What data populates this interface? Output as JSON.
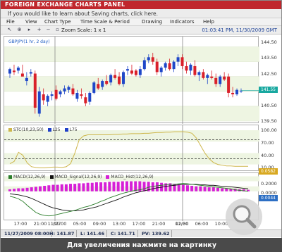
{
  "header": {
    "title": "FOREIGN EXCHANGE CHARTS PANEL",
    "info_link": "If you would like to learn about Saving charts, click here."
  },
  "menu": {
    "items": [
      "File",
      "View",
      "Chart Type",
      "Time Scale & Period",
      "Drawing",
      "Indicators",
      "Help"
    ]
  },
  "toolbar": {
    "zoom_label": "Zoom Scale: 1 x 1",
    "datetime": "01:03:41 PM, 11/30/2009 GMT"
  },
  "icons": [
    "pointer-icon",
    "crosshair-icon",
    "pan-icon",
    "zoom-in-icon",
    "zoom-out-icon",
    "zoom-fit-icon"
  ],
  "colors": {
    "header_red": "#c0272d",
    "bull": "#1f47c8",
    "bear": "#d9202a",
    "stc": "#cdb64a",
    "macd": "#2a7d2a",
    "signal": "#111111",
    "hist": "#d61fd6",
    "price_tag": "#18a8a0",
    "stc_tag": "#d8a820",
    "macd_tag": "#2d6fc4"
  },
  "price_panel": {
    "legend": "GBPJPY(1 hr, 2 day)",
    "y_ticks": [
      "144.50",
      "143.50",
      "142.50",
      "141.50",
      "140.50",
      "139.50"
    ],
    "last_price": "141.55"
  },
  "stc_panel": {
    "legend_items": [
      "STC(10,23,50)",
      "L25",
      "L75"
    ],
    "y_ticks": [
      "100.00",
      "70.00",
      "40.00",
      "10.00"
    ],
    "last_value": "0.0582"
  },
  "macd_panel": {
    "legend_items": [
      "MACD(12,26,9)",
      "MACD_Signal(12,26,9)",
      "MACD_Hist(12,26,9)"
    ],
    "y_ticks": [
      "0.2000",
      "0.0000"
    ],
    "last_value": "0.0044"
  },
  "x_axis": {
    "labels": [
      "17:00",
      "21:00",
      "01:00",
      "05:00",
      "09:00",
      "13:00",
      "17:00",
      "21:00",
      "02:00",
      "06:00",
      "10:00"
    ],
    "date_labels": [
      "11/27",
      "11/30"
    ]
  },
  "status": {
    "datetime": "11/27/2009 08:00",
    "high": "H: 141.87",
    "low": "L: 141.46",
    "close": "C: 141.71",
    "pivot": "PV: 139.62"
  },
  "caption": "Для увеличения нажмите на картинку",
  "chart_data": [
    {
      "type": "candlestick",
      "title": "GBPJPY(1 hr, 2 day)",
      "ylim": [
        139.5,
        145.0
      ],
      "candles": [
        {
          "o": 142.7,
          "h": 143.1,
          "l": 142.4,
          "c": 143.0
        },
        {
          "o": 142.9,
          "h": 143.3,
          "l": 142.6,
          "c": 142.8
        },
        {
          "o": 142.9,
          "h": 143.2,
          "l": 142.7,
          "c": 143.1
        },
        {
          "o": 142.7,
          "h": 143.3,
          "l": 142.5,
          "c": 142.5
        },
        {
          "o": 142.2,
          "h": 142.8,
          "l": 141.9,
          "c": 142.4
        },
        {
          "o": 142.7,
          "h": 143.0,
          "l": 142.5,
          "c": 142.8
        },
        {
          "o": 142.7,
          "h": 142.9,
          "l": 140.0,
          "c": 140.4
        },
        {
          "o": 140.0,
          "h": 141.8,
          "l": 139.8,
          "c": 141.5
        },
        {
          "o": 141.3,
          "h": 141.7,
          "l": 140.6,
          "c": 140.9
        },
        {
          "o": 140.8,
          "h": 141.3,
          "l": 140.5,
          "c": 141.2
        },
        {
          "o": 141.2,
          "h": 141.5,
          "l": 140.9,
          "c": 141.3
        },
        {
          "o": 141.6,
          "h": 141.9,
          "l": 140.9,
          "c": 141.0
        },
        {
          "o": 141.3,
          "h": 141.6,
          "l": 141.1,
          "c": 141.5
        },
        {
          "o": 141.5,
          "h": 141.9,
          "l": 141.3,
          "c": 141.7
        },
        {
          "o": 141.6,
          "h": 141.9,
          "l": 141.4,
          "c": 141.8
        },
        {
          "o": 141.7,
          "h": 142.0,
          "l": 141.2,
          "c": 141.3
        },
        {
          "o": 141.0,
          "h": 141.6,
          "l": 140.8,
          "c": 141.4
        },
        {
          "o": 141.3,
          "h": 141.7,
          "l": 141.0,
          "c": 141.2
        },
        {
          "o": 141.1,
          "h": 141.4,
          "l": 140.5,
          "c": 140.7
        },
        {
          "o": 140.8,
          "h": 141.5,
          "l": 140.6,
          "c": 141.4
        },
        {
          "o": 141.4,
          "h": 142.2,
          "l": 141.3,
          "c": 142.1
        },
        {
          "o": 142.0,
          "h": 142.4,
          "l": 141.6,
          "c": 141.7
        },
        {
          "o": 141.8,
          "h": 142.3,
          "l": 141.6,
          "c": 142.2
        },
        {
          "o": 142.2,
          "h": 142.6,
          "l": 141.9,
          "c": 142.0
        },
        {
          "o": 142.1,
          "h": 142.7,
          "l": 141.9,
          "c": 142.6
        },
        {
          "o": 142.6,
          "h": 143.0,
          "l": 142.3,
          "c": 142.4
        },
        {
          "o": 142.5,
          "h": 142.8,
          "l": 141.9,
          "c": 142.0
        },
        {
          "o": 142.0,
          "h": 142.9,
          "l": 141.8,
          "c": 142.8
        },
        {
          "o": 142.9,
          "h": 143.2,
          "l": 142.6,
          "c": 143.0
        },
        {
          "o": 142.9,
          "h": 143.3,
          "l": 142.6,
          "c": 142.7
        },
        {
          "o": 142.9,
          "h": 143.0,
          "l": 142.5,
          "c": 142.6
        },
        {
          "o": 142.6,
          "h": 143.2,
          "l": 142.4,
          "c": 143.0
        },
        {
          "o": 143.0,
          "h": 143.8,
          "l": 142.9,
          "c": 143.6
        },
        {
          "o": 143.6,
          "h": 144.0,
          "l": 143.4,
          "c": 143.8
        },
        {
          "o": 143.8,
          "h": 144.1,
          "l": 143.3,
          "c": 143.5
        },
        {
          "o": 143.5,
          "h": 143.7,
          "l": 142.6,
          "c": 142.8
        },
        {
          "o": 142.8,
          "h": 143.2,
          "l": 142.5,
          "c": 143.1
        },
        {
          "o": 143.1,
          "h": 143.5,
          "l": 142.9,
          "c": 143.4
        },
        {
          "o": 143.4,
          "h": 143.7,
          "l": 142.9,
          "c": 143.0
        },
        {
          "o": 143.0,
          "h": 143.6,
          "l": 142.8,
          "c": 143.5
        },
        {
          "o": 143.5,
          "h": 144.0,
          "l": 143.2,
          "c": 143.8
        },
        {
          "o": 143.8,
          "h": 144.0,
          "l": 143.0,
          "c": 143.2
        },
        {
          "o": 143.2,
          "h": 143.5,
          "l": 142.7,
          "c": 142.9
        },
        {
          "o": 142.9,
          "h": 143.4,
          "l": 142.6,
          "c": 143.3
        },
        {
          "o": 143.2,
          "h": 143.6,
          "l": 142.5,
          "c": 142.6
        },
        {
          "o": 142.6,
          "h": 142.9,
          "l": 142.2,
          "c": 142.8
        },
        {
          "o": 142.8,
          "h": 143.0,
          "l": 142.3,
          "c": 142.4
        },
        {
          "o": 142.4,
          "h": 142.7,
          "l": 142.0,
          "c": 142.6
        },
        {
          "o": 142.5,
          "h": 142.9,
          "l": 142.3,
          "c": 142.4
        },
        {
          "o": 142.4,
          "h": 142.7,
          "l": 141.8,
          "c": 142.0
        },
        {
          "o": 142.0,
          "h": 142.6,
          "l": 141.8,
          "c": 142.5
        },
        {
          "o": 142.5,
          "h": 142.8,
          "l": 142.2,
          "c": 142.3
        },
        {
          "o": 142.5,
          "h": 142.7,
          "l": 141.1,
          "c": 141.4
        },
        {
          "o": 141.4,
          "h": 141.8,
          "l": 141.1,
          "c": 141.3
        },
        {
          "o": 141.3,
          "h": 141.7,
          "l": 141.2,
          "c": 141.6
        },
        {
          "o": 141.5,
          "h": 141.7,
          "l": 141.4,
          "c": 141.55
        }
      ]
    },
    {
      "type": "line",
      "title": "STC(10,23,50)",
      "ylim": [
        0,
        100
      ],
      "series": [
        {
          "name": "STC(10,23,50)",
          "values": [
            12,
            18,
            42,
            34,
            14,
            4,
            2,
            1,
            1,
            2,
            3,
            3,
            2,
            4,
            12,
            40,
            75,
            85,
            88,
            88,
            88,
            88,
            88,
            88,
            89,
            89,
            90,
            90,
            91,
            91,
            91,
            92,
            92,
            93,
            94,
            94,
            95,
            95,
            96,
            96,
            96,
            95,
            92,
            80,
            60,
            40,
            25,
            15,
            10,
            8,
            6,
            6,
            5,
            5,
            5,
            5
          ]
        },
        {
          "name": "L25",
          "values": [
            25
          ]
        },
        {
          "name": "L75",
          "values": [
            75
          ]
        }
      ]
    },
    {
      "type": "line",
      "title": "MACD(12,26,9)",
      "ylim": [
        -0.55,
        0.32
      ],
      "series": [
        {
          "name": "MACD(12,26,9)",
          "values": [
            -0.1,
            -0.12,
            -0.15,
            -0.2,
            -0.28,
            -0.35,
            -0.42,
            -0.46,
            -0.48,
            -0.49,
            -0.48,
            -0.46,
            -0.44,
            -0.42,
            -0.4,
            -0.38,
            -0.35,
            -0.32,
            -0.3,
            -0.27,
            -0.24,
            -0.2,
            -0.17,
            -0.13,
            -0.1,
            -0.07,
            -0.04,
            -0.02,
            0.0,
            0.02,
            0.03,
            0.05,
            0.08,
            0.1,
            0.11,
            0.12,
            0.13,
            0.14,
            0.14,
            0.15,
            0.16,
            0.15,
            0.14,
            0.13,
            0.12,
            0.11,
            0.1,
            0.09,
            0.08,
            0.07,
            0.06,
            0.05,
            0.03,
            0.02,
            0.01,
            0.0
          ]
        },
        {
          "name": "MACD_Signal(12,26,9)",
          "values": [
            -0.05,
            -0.06,
            -0.07,
            -0.09,
            -0.11,
            -0.14,
            -0.18,
            -0.22,
            -0.26,
            -0.3,
            -0.33,
            -0.35,
            -0.37,
            -0.38,
            -0.39,
            -0.39,
            -0.38,
            -0.37,
            -0.35,
            -0.33,
            -0.31,
            -0.28,
            -0.25,
            -0.22,
            -0.19,
            -0.16,
            -0.12,
            -0.09,
            -0.06,
            -0.03,
            -0.01,
            0.01,
            0.03,
            0.05,
            0.07,
            0.08,
            0.1,
            0.11,
            0.12,
            0.13,
            0.13,
            0.14,
            0.14,
            0.14,
            0.13,
            0.13,
            0.12,
            0.12,
            0.11,
            0.1,
            0.1,
            0.09,
            0.08,
            0.07,
            0.06,
            0.05
          ]
        },
        {
          "name": "MACD_Hist(12,26,9)",
          "values": [
            0.04,
            0.05,
            0.06,
            0.06,
            0.07,
            0.08,
            0.09,
            0.1,
            0.11,
            0.12,
            0.13,
            0.13,
            0.14,
            0.14,
            0.15,
            0.15,
            0.16,
            0.16,
            0.17,
            0.17,
            0.18,
            0.18,
            0.18,
            0.19,
            0.19,
            0.19,
            0.2,
            0.2,
            0.2,
            0.2,
            0.2,
            0.19,
            0.19,
            0.18,
            0.18,
            0.17,
            0.16,
            0.16,
            0.15,
            0.14,
            0.13,
            0.12,
            0.11,
            0.1,
            0.1,
            0.09,
            0.08,
            0.08,
            0.07,
            0.06,
            0.06,
            0.05,
            0.05,
            0.04,
            0.04,
            0.03
          ]
        }
      ]
    }
  ]
}
